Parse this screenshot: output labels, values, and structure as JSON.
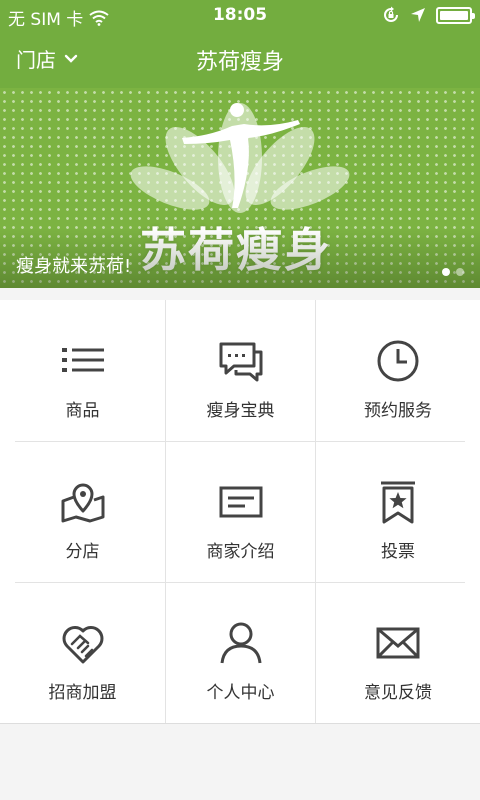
{
  "status_bar": {
    "carrier": "无 SIM 卡",
    "time": "18:05",
    "battery_level": 1.0
  },
  "navbar": {
    "store_label": "门店",
    "title": "苏荷瘦身"
  },
  "banner": {
    "logo_text": "苏荷瘦身",
    "caption": "瘦身就来苏荷!",
    "page_count": 2,
    "active_page": 1
  },
  "menu": [
    {
      "label": "商品",
      "icon": "list-icon"
    },
    {
      "label": "瘦身宝典",
      "icon": "chat-bubbles-icon"
    },
    {
      "label": "预约服务",
      "icon": "clock-icon"
    },
    {
      "label": "分店",
      "icon": "map-pin-icon"
    },
    {
      "label": "商家介绍",
      "icon": "message-card-icon"
    },
    {
      "label": "投票",
      "icon": "star-bookmark-icon"
    },
    {
      "label": "招商加盟",
      "icon": "heart-handshake-icon"
    },
    {
      "label": "个人中心",
      "icon": "user-icon"
    },
    {
      "label": "意见反馈",
      "icon": "envelope-icon"
    }
  ],
  "colors": {
    "brand_green": "#73ad3f",
    "icon_gray": "#444444"
  }
}
